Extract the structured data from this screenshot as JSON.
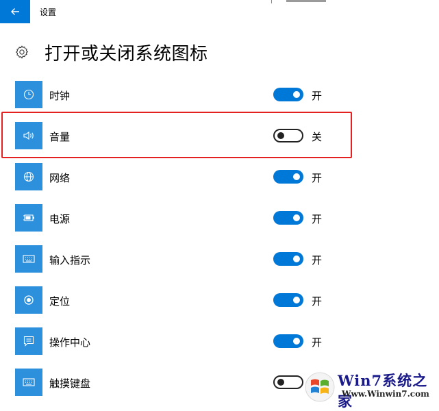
{
  "window": {
    "title": "设置"
  },
  "page": {
    "title": "打开或关闭系统图标"
  },
  "settings": [
    {
      "icon": "clock-icon",
      "label": "时钟",
      "on": true,
      "state": "开"
    },
    {
      "icon": "volume-icon",
      "label": "音量",
      "on": false,
      "state": "关"
    },
    {
      "icon": "network-icon",
      "label": "网络",
      "on": true,
      "state": "开"
    },
    {
      "icon": "power-icon",
      "label": "电源",
      "on": true,
      "state": "开"
    },
    {
      "icon": "keyboard-icon",
      "label": "输入指示",
      "on": true,
      "state": "开"
    },
    {
      "icon": "location-icon",
      "label": "定位",
      "on": true,
      "state": "开"
    },
    {
      "icon": "action-center-icon",
      "label": "操作中心",
      "on": true,
      "state": "开"
    },
    {
      "icon": "touch-keyboard-icon",
      "label": "触摸键盘",
      "on": false,
      "state": ""
    }
  ],
  "colors": {
    "accent": "#0078d7",
    "tile": "#2d90dc",
    "highlight": "#e52020"
  },
  "watermark": {
    "brand": "Win7系统之家",
    "url": "Www.Winwin7.com"
  }
}
